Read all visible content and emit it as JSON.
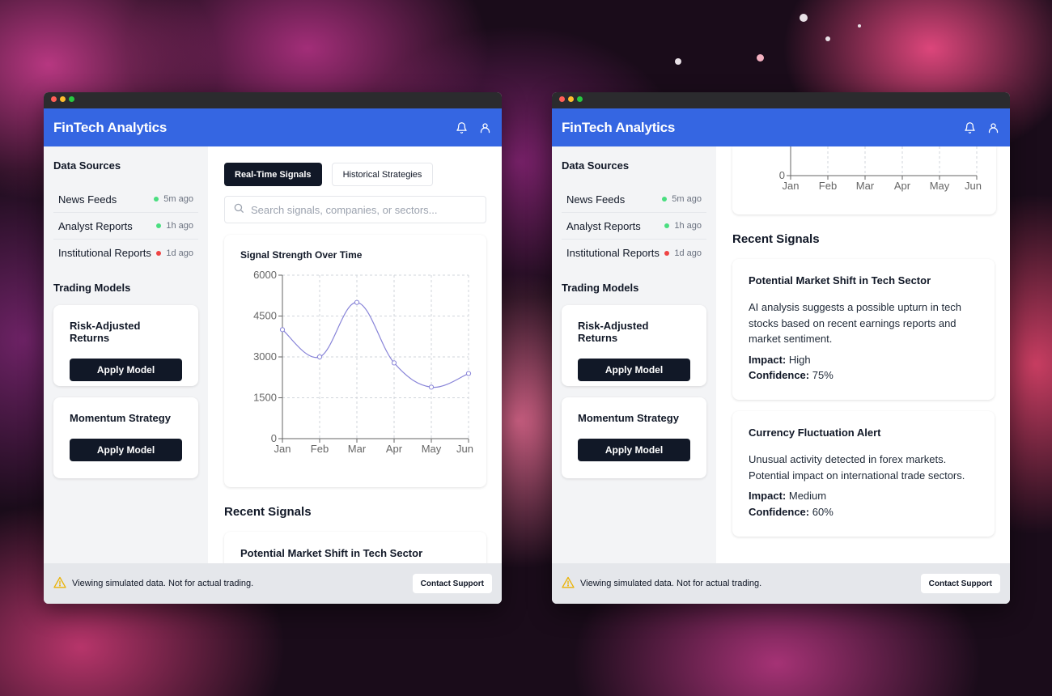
{
  "app": {
    "title": "FinTech Analytics"
  },
  "sidebar": {
    "data_sources_heading": "Data Sources",
    "sources": [
      {
        "name": "News Feeds",
        "time": "5m ago",
        "status_color": "#4ade80"
      },
      {
        "name": "Analyst Reports",
        "time": "1h ago",
        "status_color": "#4ade80"
      },
      {
        "name": "Institutional Reports",
        "time": "1d ago",
        "status_color": "#ef4444"
      }
    ],
    "models_heading": "Trading Models",
    "models": [
      {
        "name": "Risk-Adjusted Returns",
        "button": "Apply Model"
      },
      {
        "name": "Momentum Strategy",
        "button": "Apply Model"
      }
    ]
  },
  "tabs": {
    "active": "Real-Time Signals",
    "inactive": "Historical Strategies"
  },
  "search": {
    "placeholder": "Search signals, companies, or sectors..."
  },
  "chart_data": {
    "type": "line",
    "title": "Signal Strength Over Time",
    "categories": [
      "Jan",
      "Feb",
      "Mar",
      "Apr",
      "May",
      "Jun"
    ],
    "values": [
      4000,
      3000,
      5000,
      2780,
      1890,
      2390
    ],
    "yticks": [
      "0",
      "1500",
      "3000",
      "4500",
      "6000"
    ],
    "ylim": [
      0,
      6000
    ],
    "grid": true,
    "line_color": "#8884d8"
  },
  "signals": {
    "heading": "Recent Signals",
    "items": [
      {
        "title": "Potential Market Shift in Tech Sector",
        "description": "AI analysis suggests a possible upturn in tech stocks based on recent earnings reports and market sentiment.",
        "impact_label": "Impact:",
        "impact": "High",
        "confidence_label": "Confidence:",
        "confidence": "75%"
      },
      {
        "title": "Currency Fluctuation Alert",
        "description": "Unusual activity detected in forex markets. Potential impact on international trade sectors.",
        "impact_label": "Impact:",
        "impact": "Medium",
        "confidence_label": "Confidence:",
        "confidence": "60%"
      }
    ]
  },
  "footer": {
    "notice": "Viewing simulated data. Not for actual trading.",
    "support_button": "Contact Support"
  },
  "colors": {
    "accent": "#3566e2",
    "dark": "#111827"
  }
}
